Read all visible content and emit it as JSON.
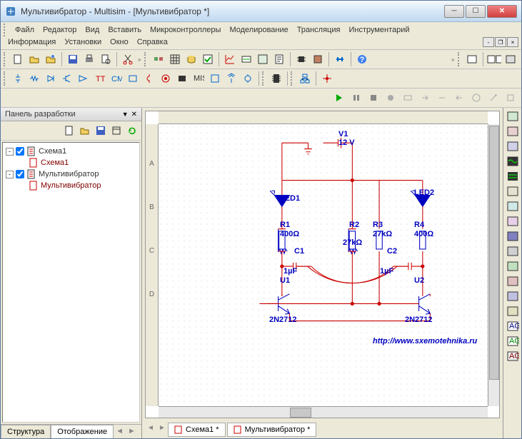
{
  "window": {
    "title": "Мультивибратор - Multisim - [Мультивибратор *]"
  },
  "menu": {
    "row1": [
      "Файл",
      "Редактор",
      "Вид",
      "Вставить",
      "Микроконтроллеры",
      "Моделирование",
      "Трансляция",
      "Инструментарий"
    ],
    "row2": [
      "Информация",
      "Установки",
      "Окно",
      "Справка"
    ]
  },
  "panel": {
    "title": "Панель разработки",
    "tabs": {
      "structure": "Структура",
      "display": "Отображение"
    }
  },
  "tree": {
    "items": [
      {
        "indent": 0,
        "toggle": "-",
        "cb": true,
        "icon": "doc",
        "label": "Схема1",
        "color": ""
      },
      {
        "indent": 1,
        "toggle": "",
        "cb": false,
        "icon": "page",
        "label": "Схема1",
        "color": "maroon"
      },
      {
        "indent": 0,
        "toggle": "-",
        "cb": true,
        "icon": "doc",
        "label": "Мультивибратор",
        "color": ""
      },
      {
        "indent": 1,
        "toggle": "",
        "cb": false,
        "icon": "page",
        "label": "Мультивибратор",
        "color": "maroon"
      }
    ]
  },
  "docs": {
    "tab1": "Схема1 *",
    "tab2": "Мультивибратор *"
  },
  "circuit": {
    "v1": {
      "name": "V1",
      "val": "12 V"
    },
    "led1": "LED1",
    "led2": "LED2",
    "r1": {
      "n": "R1",
      "v": "400Ω"
    },
    "r2": {
      "n": "R2",
      "v": "27kΩ"
    },
    "r3": {
      "n": "R3",
      "v": "27kΩ"
    },
    "r4": {
      "n": "R4",
      "v": "400Ω"
    },
    "c1": {
      "n": "C1",
      "v": "1µF"
    },
    "c2": {
      "n": "C2",
      "v": "1µF"
    },
    "u1": "U1",
    "u2": "U2",
    "q1": "2N2712",
    "q2": "2N2712",
    "url": "http://www.sxemotehnika.ru"
  },
  "rulerV": [
    "A",
    "B",
    "C",
    "D"
  ]
}
